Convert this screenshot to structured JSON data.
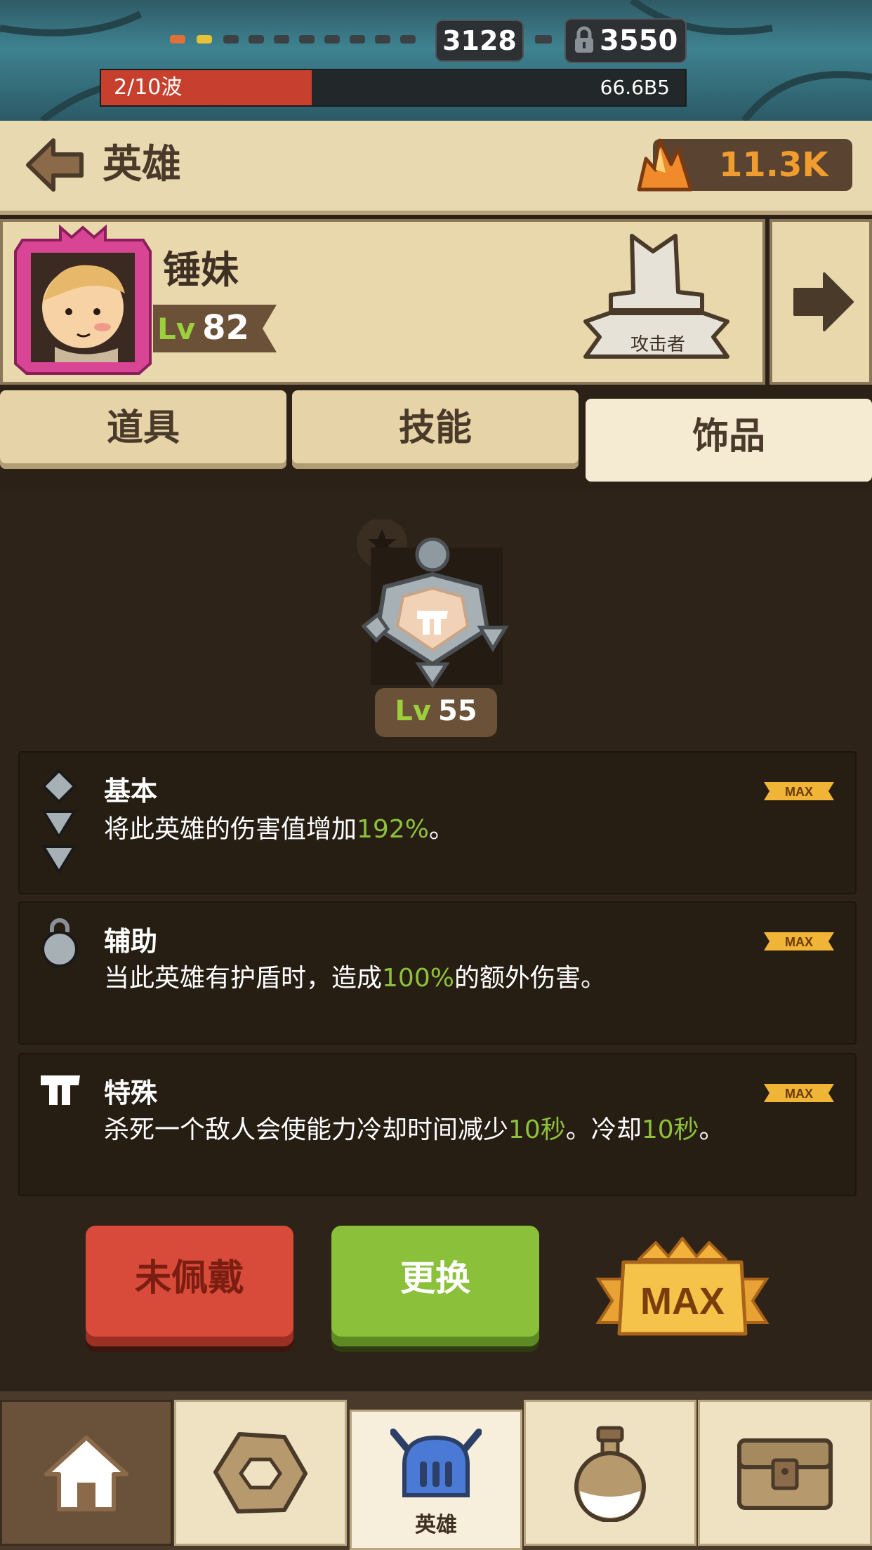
{
  "hud": {
    "score": "3128",
    "best_score": "3550",
    "wave_label": "2/10波",
    "wave_progress": 0.36,
    "wave_value": "66.6B5"
  },
  "header": {
    "title": "英雄",
    "currency": "11.3K"
  },
  "hero": {
    "name": "锤妹",
    "level_prefix": "Lv",
    "level": "82",
    "role": "攻击者"
  },
  "tabs": [
    {
      "label": "道具",
      "active": false
    },
    {
      "label": "技能",
      "active": false
    },
    {
      "label": "饰品",
      "active": true
    }
  ],
  "charm": {
    "level_prefix": "Lv",
    "level": "55"
  },
  "stats": [
    {
      "title": "基本",
      "pre": "将此英雄的伤害值增加",
      "value": "192%",
      "post": "。",
      "badge": "MAX"
    },
    {
      "title": "辅助",
      "pre": "当此英雄有护盾时，造成",
      "value": "100%",
      "post": "的额外伤害。",
      "badge": "MAX"
    },
    {
      "title": "特殊",
      "pre": "杀死一个敌人会使能力冷却时间减少",
      "value": "10秒",
      "mid": "。冷却",
      "value2": "10秒",
      "post": "。",
      "badge": "MAX"
    }
  ],
  "actions": {
    "unequip": "未佩戴",
    "change": "更换",
    "max": "MAX"
  },
  "nav": {
    "active_label": "英雄"
  },
  "colors": {
    "highlight": "#8ec13a",
    "red_button": "#d84a3a",
    "green_button": "#8ac03a",
    "currency": "#f19c2e"
  }
}
